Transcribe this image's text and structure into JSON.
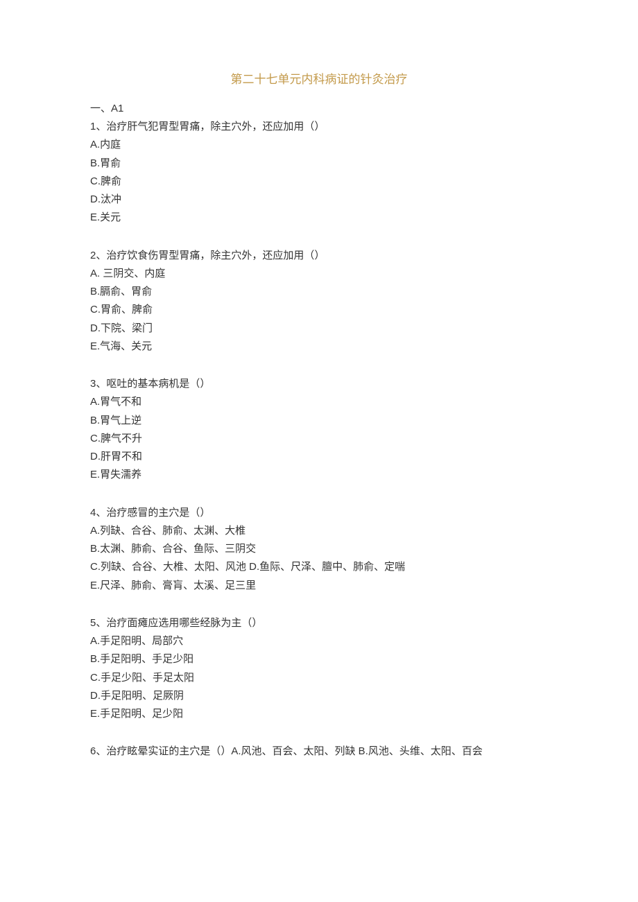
{
  "title": "第二十七单元内科病证的针灸治疗",
  "section_label": "一、A1",
  "questions": [
    {
      "stem": "1、治疗肝气犯胃型胃痛，除主穴外，还应加用（）",
      "options": [
        "A.内庭",
        "B.胃俞",
        "C.脾俞",
        "D.汰冲",
        "E.关元"
      ]
    },
    {
      "stem": "2、治疗饮食伤胃型胃痛，除主穴外，还应加用（）",
      "options": [
        "A. 三阴交、内庭",
        "B.膈俞、胃俞",
        "C.胃俞、脾俞",
        "D.下院、梁门",
        "E.气海、关元"
      ]
    },
    {
      "stem": "3、呕吐的基本病机是（）",
      "options": [
        "A.胃气不和",
        "B.胃气上逆",
        "C.脾气不升",
        "D.肝胃不和",
        "E.胃失濡养"
      ]
    },
    {
      "stem": "4、治疗感冒的主穴是（）",
      "options": [
        "A.列缺、合谷、肺俞、太渊、大椎",
        "B.太渊、肺俞、合谷、鱼际、三阴交",
        "C.列缺、合谷、大椎、太阳、风池 D.鱼际、尺泽、膻中、肺俞、定喘",
        "E.尺泽、肺俞、膏肓、太溪、足三里"
      ]
    },
    {
      "stem": "5、治疗面瘫应选用哪些经脉为主（）",
      "options": [
        "A.手足阳明、局部穴",
        "B.手足阳明、手足少阳",
        "C.手足少阳、手足太阳",
        "D.手足阳明、足厥阴",
        "E.手足阳明、足少阳"
      ]
    },
    {
      "stem": "6、治疗眩晕实证的主穴是（）A.风池、百会、太阳、列缺 B.风池、头维、太阳、百会",
      "options": []
    }
  ]
}
